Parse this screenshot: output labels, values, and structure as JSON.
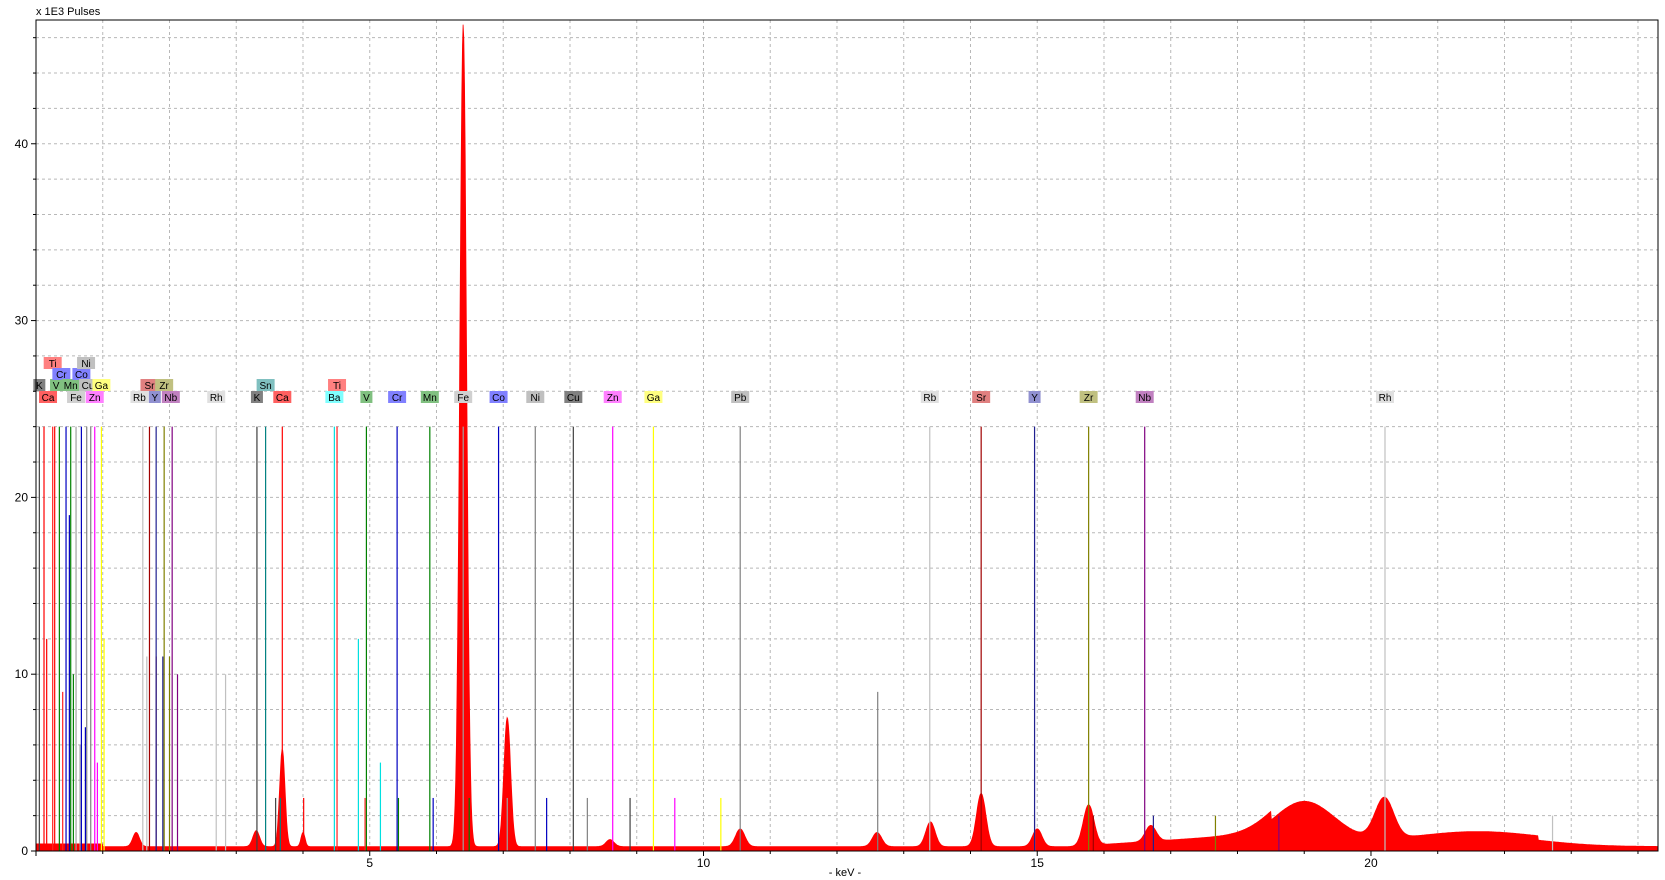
{
  "chart_data": {
    "type": "area",
    "title": "",
    "ylabel": "x 1E3 Pulses",
    "xlabel": "- keV -",
    "xlim": [
      0,
      24.3
    ],
    "ylim": [
      0,
      47
    ],
    "x_ticks": [
      5,
      10,
      15,
      20
    ],
    "y_ticks": [
      0,
      10,
      20,
      30,
      40
    ],
    "grid": true,
    "spectrum_color": "#ff0000",
    "peaks": [
      {
        "x": 1.5,
        "height": 0.8,
        "width": 0.05
      },
      {
        "x": 3.3,
        "height": 0.9,
        "width": 0.05
      },
      {
        "x": 3.69,
        "height": 5.5,
        "width": 0.04
      },
      {
        "x": 4.0,
        "height": 0.8,
        "width": 0.03
      },
      {
        "x": 6.4,
        "height": 46.5,
        "width": 0.05
      },
      {
        "x": 7.06,
        "height": 7.3,
        "width": 0.05
      },
      {
        "x": 8.6,
        "height": 0.4,
        "width": 0.06
      },
      {
        "x": 10.55,
        "height": 1.0,
        "width": 0.07
      },
      {
        "x": 12.6,
        "height": 0.8,
        "width": 0.07
      },
      {
        "x": 13.4,
        "height": 1.4,
        "width": 0.07
      },
      {
        "x": 14.16,
        "height": 3.0,
        "width": 0.07
      },
      {
        "x": 15.0,
        "height": 1.0,
        "width": 0.07
      },
      {
        "x": 15.77,
        "height": 2.3,
        "width": 0.08
      },
      {
        "x": 16.7,
        "height": 0.9,
        "width": 0.08
      },
      {
        "x": 19.0,
        "height": 2.3,
        "width": 0.45
      },
      {
        "x": 20.2,
        "height": 2.3,
        "width": 0.14
      },
      {
        "x": 21.6,
        "height": 0.6,
        "width": 0.9
      }
    ],
    "element_markers": [
      {
        "label": "K",
        "x": 0.05,
        "row": 2,
        "color": "#808080",
        "lines": [
          {
            "x": 0.05,
            "h": 24
          }
        ]
      },
      {
        "label": "Ca",
        "x": 0.18,
        "row": 1,
        "color": "#ff6060",
        "lines": [
          {
            "x": 0.12,
            "h": 24
          },
          {
            "x": 0.16,
            "h": 12
          },
          {
            "x": 0.28,
            "h": 24
          }
        ]
      },
      {
        "label": "Ti",
        "x": 0.25,
        "row": 4,
        "color": "#ff8080",
        "lines": [
          {
            "x": 0.25,
            "h": 24
          },
          {
            "x": 0.4,
            "h": 9
          }
        ]
      },
      {
        "label": "V",
        "x": 0.3,
        "row": 2,
        "color": "#80c080",
        "lines": [
          {
            "x": 0.35,
            "h": 24
          }
        ]
      },
      {
        "label": "Cr",
        "x": 0.38,
        "row": 3,
        "color": "#8080ff",
        "lines": [
          {
            "x": 0.45,
            "h": 24
          },
          {
            "x": 0.5,
            "h": 19
          }
        ]
      },
      {
        "label": "Mn",
        "x": 0.52,
        "row": 2,
        "color": "#80c080",
        "lines": [
          {
            "x": 0.52,
            "h": 24
          },
          {
            "x": 0.56,
            "h": 10
          }
        ]
      },
      {
        "label": "Fe",
        "x": 0.6,
        "row": 1,
        "color": "#d0d0d0",
        "lines": [
          {
            "x": 0.6,
            "h": 24
          },
          {
            "x": 0.66,
            "h": 6
          }
        ]
      },
      {
        "label": "Co",
        "x": 0.68,
        "row": 3,
        "color": "#8080ff",
        "lines": [
          {
            "x": 0.68,
            "h": 24
          },
          {
            "x": 0.74,
            "h": 7
          }
        ]
      },
      {
        "label": "Ni",
        "x": 0.75,
        "row": 4,
        "color": "#c0c0c0",
        "lines": [
          {
            "x": 0.76,
            "h": 24
          }
        ]
      },
      {
        "label": "Cu",
        "x": 0.78,
        "row": 2,
        "color": "#c0c0c0",
        "lines": [
          {
            "x": 0.82,
            "h": 24
          }
        ]
      },
      {
        "label": "Zn",
        "x": 0.88,
        "row": 1,
        "color": "#ff80ff",
        "lines": [
          {
            "x": 0.88,
            "h": 24
          },
          {
            "x": 0.92,
            "h": 5
          }
        ]
      },
      {
        "label": "Ga",
        "x": 0.98,
        "row": 2,
        "color": "#ffff80",
        "lines": [
          {
            "x": 0.98,
            "h": 24
          },
          {
            "x": 1.02,
            "h": 12
          }
        ]
      },
      {
        "label": "Rb",
        "x": 1.55,
        "row": 1,
        "color": "#e0e0e0",
        "lines": [
          {
            "x": 1.6,
            "h": 24
          },
          {
            "x": 1.66,
            "h": 11
          }
        ]
      },
      {
        "label": "Sr",
        "x": 1.7,
        "row": 2,
        "color": "#e08080",
        "lines": [
          {
            "x": 1.7,
            "h": 24
          },
          {
            "x": 1.8,
            "h": 11
          }
        ]
      },
      {
        "label": "Y",
        "x": 1.78,
        "row": 1,
        "color": "#9090d0",
        "lines": [
          {
            "x": 1.8,
            "h": 24
          },
          {
            "x": 1.9,
            "h": 11
          }
        ]
      },
      {
        "label": "Zr",
        "x": 1.92,
        "row": 2,
        "color": "#c0c080",
        "lines": [
          {
            "x": 1.92,
            "h": 24
          },
          {
            "x": 2.0,
            "h": 11
          }
        ]
      },
      {
        "label": "Nb",
        "x": 2.02,
        "row": 1,
        "color": "#c080c0",
        "lines": [
          {
            "x": 2.04,
            "h": 24
          },
          {
            "x": 2.12,
            "h": 10
          }
        ]
      },
      {
        "label": "Rh",
        "x": 2.7,
        "row": 1,
        "color": "#e0e0e0",
        "lines": [
          {
            "x": 2.7,
            "h": 24
          },
          {
            "x": 2.84,
            "h": 10
          }
        ]
      },
      {
        "label": "K",
        "x": 3.31,
        "row": 1,
        "color": "#808080",
        "lines": [
          {
            "x": 3.31,
            "h": 24
          },
          {
            "x": 3.59,
            "h": 3
          }
        ]
      },
      {
        "label": "Sn",
        "x": 3.44,
        "row": 2,
        "color": "#80c0c0",
        "lines": [
          {
            "x": 3.44,
            "h": 24
          },
          {
            "x": 3.66,
            "h": 3
          }
        ]
      },
      {
        "label": "Ca",
        "x": 3.69,
        "row": 1,
        "color": "#ff6060",
        "lines": [
          {
            "x": 3.69,
            "h": 24
          },
          {
            "x": 4.01,
            "h": 3
          }
        ]
      },
      {
        "label": "Ti",
        "x": 4.51,
        "row": 2,
        "color": "#ff8080",
        "lines": [
          {
            "x": 4.51,
            "h": 24
          },
          {
            "x": 4.93,
            "h": 3
          }
        ]
      },
      {
        "label": "Ba",
        "x": 4.47,
        "row": 1,
        "color": "#80ffff",
        "lines": [
          {
            "x": 4.47,
            "h": 24
          },
          {
            "x": 4.83,
            "h": 12
          },
          {
            "x": 5.16,
            "h": 5
          }
        ]
      },
      {
        "label": "V",
        "x": 4.95,
        "row": 1,
        "color": "#80c080",
        "lines": [
          {
            "x": 4.95,
            "h": 24
          },
          {
            "x": 5.43,
            "h": 3
          }
        ]
      },
      {
        "label": "Cr",
        "x": 5.41,
        "row": 1,
        "color": "#8080ff",
        "lines": [
          {
            "x": 5.41,
            "h": 24
          },
          {
            "x": 5.95,
            "h": 3
          }
        ]
      },
      {
        "label": "Mn",
        "x": 5.9,
        "row": 1,
        "color": "#80c080",
        "lines": [
          {
            "x": 5.9,
            "h": 24
          },
          {
            "x": 6.49,
            "h": 3
          }
        ]
      },
      {
        "label": "Fe",
        "x": 6.4,
        "row": 1,
        "color": "#d0d0d0",
        "lines": [
          {
            "x": 6.4,
            "h": 24
          },
          {
            "x": 7.06,
            "h": 3
          }
        ]
      },
      {
        "label": "Co",
        "x": 6.93,
        "row": 1,
        "color": "#8080ff",
        "lines": [
          {
            "x": 6.93,
            "h": 24
          },
          {
            "x": 7.65,
            "h": 3
          }
        ]
      },
      {
        "label": "Ni",
        "x": 7.48,
        "row": 1,
        "color": "#c0c0c0",
        "lines": [
          {
            "x": 7.48,
            "h": 24
          },
          {
            "x": 8.26,
            "h": 3
          }
        ]
      },
      {
        "label": "Cu",
        "x": 8.05,
        "row": 1,
        "color": "#808080",
        "lines": [
          {
            "x": 8.05,
            "h": 24
          },
          {
            "x": 8.9,
            "h": 3
          }
        ]
      },
      {
        "label": "Zn",
        "x": 8.64,
        "row": 1,
        "color": "#ff80ff",
        "lines": [
          {
            "x": 8.64,
            "h": 24
          },
          {
            "x": 9.57,
            "h": 3
          }
        ]
      },
      {
        "label": "Ga",
        "x": 9.25,
        "row": 1,
        "color": "#ffff80",
        "lines": [
          {
            "x": 9.25,
            "h": 24
          },
          {
            "x": 10.26,
            "h": 3
          }
        ]
      },
      {
        "label": "Pb",
        "x": 10.55,
        "row": 1,
        "color": "#c0c0c0",
        "lines": [
          {
            "x": 10.55,
            "h": 24
          },
          {
            "x": 12.61,
            "h": 9
          }
        ]
      },
      {
        "label": "Rb",
        "x": 13.39,
        "row": 1,
        "color": "#e0e0e0",
        "lines": [
          {
            "x": 13.39,
            "h": 24
          },
          {
            "x": 14.96,
            "h": 2
          }
        ]
      },
      {
        "label": "Sr",
        "x": 14.16,
        "row": 1,
        "color": "#e08080",
        "lines": [
          {
            "x": 14.16,
            "h": 24
          },
          {
            "x": 15.84,
            "h": 2
          }
        ]
      },
      {
        "label": "Y",
        "x": 14.96,
        "row": 1,
        "color": "#9090d0",
        "lines": [
          {
            "x": 14.96,
            "h": 24
          },
          {
            "x": 16.74,
            "h": 2
          }
        ]
      },
      {
        "label": "Zr",
        "x": 15.77,
        "row": 1,
        "color": "#c0c080",
        "lines": [
          {
            "x": 15.77,
            "h": 24
          },
          {
            "x": 17.67,
            "h": 2
          }
        ]
      },
      {
        "label": "Nb",
        "x": 16.61,
        "row": 1,
        "color": "#c080c0",
        "lines": [
          {
            "x": 16.61,
            "h": 24
          },
          {
            "x": 18.62,
            "h": 2
          }
        ]
      },
      {
        "label": "Rh",
        "x": 20.21,
        "row": 1,
        "color": "#e0e0e0",
        "lines": [
          {
            "x": 20.21,
            "h": 24
          },
          {
            "x": 22.72,
            "h": 2
          }
        ]
      }
    ]
  }
}
